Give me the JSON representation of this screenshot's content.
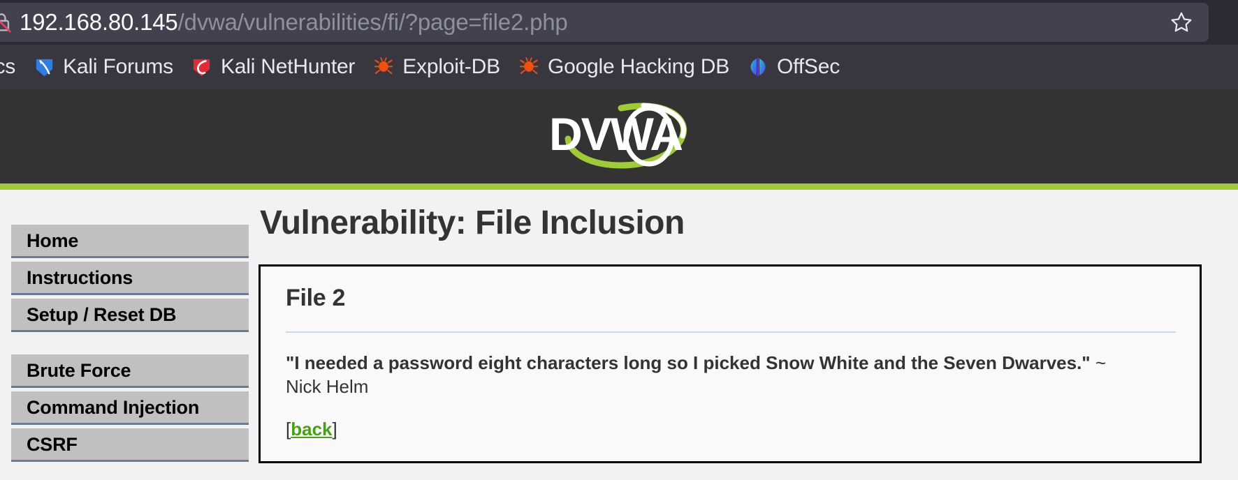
{
  "browser": {
    "security_icon": "lock-slashed-icon",
    "url": {
      "host": "192.168.80.145",
      "path": "/dvwa/vulnerabilities/fi/?page=file2.php",
      "full": "192.168.80.145/dvwa/vulnerabilities/fi/?page=file2.php"
    },
    "bookmark_star_icon": "star-icon",
    "bookmarks": [
      {
        "label": "ocs",
        "icon": "kali-docs-icon",
        "clipped": true
      },
      {
        "label": "Kali Forums",
        "icon": "kali-forums-icon",
        "clipped": false
      },
      {
        "label": "Kali NetHunter",
        "icon": "kali-nethunter-icon",
        "clipped": false
      },
      {
        "label": "Exploit-DB",
        "icon": "exploit-db-icon",
        "clipped": false
      },
      {
        "label": "Google Hacking DB",
        "icon": "google-hacking-db-icon",
        "clipped": false
      },
      {
        "label": "OffSec",
        "icon": "offsec-icon",
        "clipped": false
      }
    ]
  },
  "site": {
    "logo_text": "DVWA",
    "accent_green": "#9fcb3b",
    "header_bg": "#333333"
  },
  "sidebar": {
    "groups": [
      {
        "items": [
          {
            "label": "Home"
          },
          {
            "label": "Instructions"
          },
          {
            "label": "Setup / Reset DB"
          }
        ]
      },
      {
        "items": [
          {
            "label": "Brute Force"
          },
          {
            "label": "Command Injection"
          },
          {
            "label": "CSRF"
          }
        ]
      }
    ]
  },
  "main": {
    "page_title": "Vulnerability: File Inclusion",
    "box": {
      "title": "File 2",
      "quote": "\"I needed a password eight characters long so I picked Snow White and the Seven Dwarves.\"",
      "tilde": " ~",
      "author": "Nick Helm",
      "back_bracket_open": "[",
      "back_label": "back",
      "back_bracket_close": "]",
      "back_link_color": "#4a9f19"
    }
  }
}
